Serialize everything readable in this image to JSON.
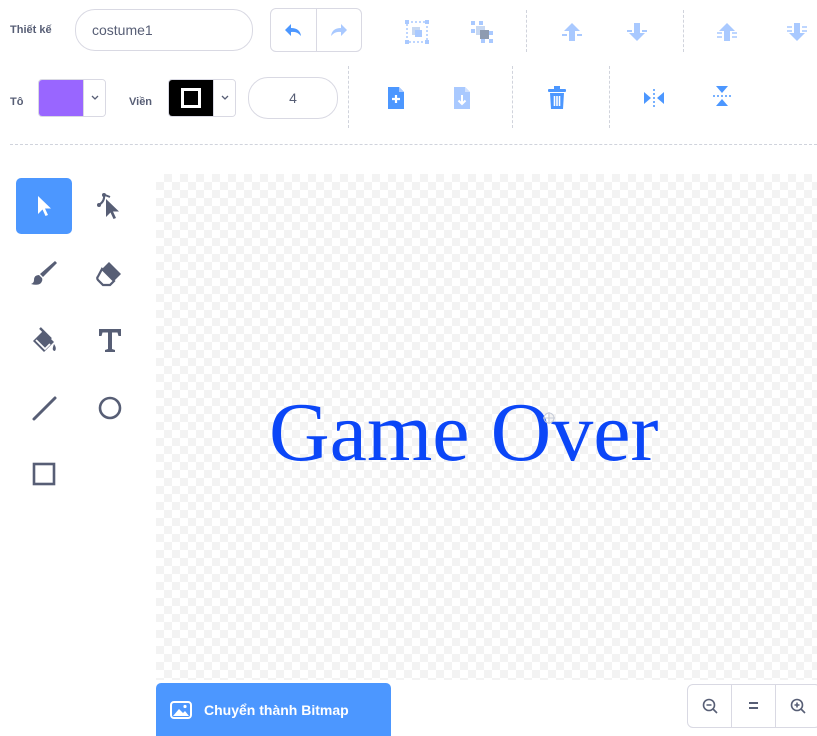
{
  "toolbar": {
    "costume_label": "Thiết kế",
    "costume_name": "costume1",
    "fill_label": "Tô",
    "fill_color": "#9966ff",
    "outline_label": "Viền",
    "outline_color": "#000000",
    "outline_width": "4"
  },
  "tools": [
    {
      "name": "select",
      "active": true
    },
    {
      "name": "reshape"
    },
    {
      "name": "brush"
    },
    {
      "name": "eraser"
    },
    {
      "name": "fill"
    },
    {
      "name": "text"
    },
    {
      "name": "line"
    },
    {
      "name": "circle"
    },
    {
      "name": "rectangle"
    }
  ],
  "canvas": {
    "text": "Game Over",
    "text_color": "#0b46f7"
  },
  "footer": {
    "bitmap_button_label": "Chuyển thành Bitmap",
    "zoom_reset_label": "="
  },
  "colors": {
    "accent": "#4c97ff",
    "icon": "#575e75"
  }
}
